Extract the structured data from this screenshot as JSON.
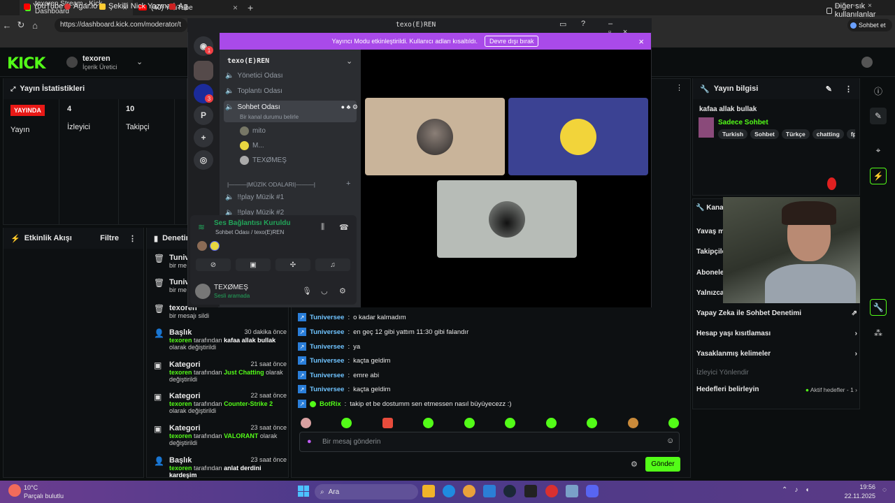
{
  "browser": {
    "tabs": [
      {
        "label": "texoren Stream - Kick Dashboard"
      },
      {
        "label": "(40) YouTube"
      }
    ],
    "url": "https://dashboard.kick.com/moderator/t",
    "bookmarks": [
      "YouTube",
      "Agar.io",
      "Şekilli Nick Yazma |...",
      "Ag"
    ],
    "other_bookmarks": "Diğer sık kullanılanlar",
    "profile_label": "Sohbet et"
  },
  "kick": {
    "logo": "KICK",
    "user_name": "texoren",
    "user_role": "İçerik Üretici",
    "stats_title": "Yayın İstatistikleri",
    "live_badge": "YAYINDA",
    "live_label": "Yayın",
    "viewers_value": "4",
    "viewers_label": "İzleyici",
    "followers_value": "10",
    "followers_label": "Takipçi",
    "activity_title": "Etkinlik Akışı",
    "filter_label": "Filtre",
    "moderation_title": "Denetim",
    "mod_log": [
      {
        "title": "Tuniv",
        "desc": "bir me",
        "time": ""
      },
      {
        "title": "Tuniv",
        "desc": "bir me",
        "time": ""
      },
      {
        "title": "texoren",
        "desc": "bir mesajı sildi",
        "time": ""
      },
      {
        "title": "Başlık",
        "time": "30 dakika önce",
        "user": "texoren",
        "mid": " tarafından ",
        "value": "kafaa allak bullak",
        "tail": " olarak değiştirildi"
      },
      {
        "title": "Kategori",
        "time": "21 saat önce",
        "user": "texoren",
        "mid": " tarafından ",
        "value": "Just Chatting",
        "tail": " olarak değiştirildi"
      },
      {
        "title": "Kategori",
        "time": "22 saat önce",
        "user": "texoren",
        "mid": " tarafından ",
        "value": "Counter-Strike 2",
        "tail": " olarak değiştirildi"
      },
      {
        "title": "Kategori",
        "time": "23 saat önce",
        "user": "texoren",
        "mid": " tarafından ",
        "value": "VALORANT",
        "tail": " olarak değiştirildi"
      },
      {
        "title": "Başlık",
        "time": "23 saat önce",
        "user": "texoren",
        "mid": " tarafından ",
        "value": "anlat derdini kardeşim",
        "tail": ""
      }
    ],
    "chat": [
      {
        "user": "Tuniversee",
        "msg": "o kadar kalmadım"
      },
      {
        "user": "Tuniversee",
        "msg": "en geç 12 gibi yattım 11:30 gibi falandır"
      },
      {
        "user": "Tuniversee",
        "msg": "ya"
      },
      {
        "user": "Tuniversee",
        "msg": "kaçta geldim"
      },
      {
        "user": "Tuniversee",
        "msg": "emre abi"
      },
      {
        "user": "Tuniversee",
        "msg": "kaçta geldim"
      },
      {
        "user": "BotRix",
        "msg": "takip et be dostumm sen etmessen nasıl büyüyecezz :)"
      }
    ],
    "chat_placeholder": "Bir mesaj gönderin",
    "send_label": "Gönder",
    "stream_info_title": "Yayın bilgisi",
    "stream_title": "kafaa allak bullak",
    "category": "Sadece Sohbet",
    "tags": [
      "Turkish",
      "Sohbet",
      "Türkçe",
      "chatting",
      "fps"
    ],
    "channel_title": "Kana",
    "settings_items": [
      "Yavaş m",
      "Takipçile",
      "Abonele",
      "Yalnızca"
    ],
    "ai_moderation": "Yapay Zeka ile Sohbet Denetimi",
    "age_restrict": "Hesap yaşı kısıtlaması",
    "banned_words": "Yasaklanmış kelimeler",
    "viewer_guide": "İzleyici Yönlendir",
    "set_goals": "Hedefleri belirleyin",
    "active_goals": "Aktif hedefler - 1"
  },
  "discord": {
    "window_title": "texo(E)REN",
    "notice": "Yayıncı Modu etkinleştirildi. Kullanıcı adları kısaltıldı.",
    "notice_button": "Devre dışı bırak",
    "server_name": "texo(E)REN",
    "guild_badges": [
      "1",
      "3"
    ],
    "guild_letter": "P",
    "channels": [
      "Yönetici Odası",
      "Toplantı Odası",
      "Sohbet Odası"
    ],
    "channel_status": "Bir kanal durumu belirle",
    "members": [
      "mito",
      "M...",
      "TEXØMEŞ"
    ],
    "music_category": "|———|MÜZİK ODALARI|———|",
    "music_channels": [
      "!!play Müzik #1",
      "!!play Müzik #2"
    ],
    "voice_status": "Ses Bağlantısı Kuruldu",
    "voice_location": "Sohbet Odası / texo(E)REN",
    "self_name": "TEXØMEŞ",
    "self_status": "Sesli aramada"
  },
  "taskbar": {
    "weather_temp": "10°C",
    "weather_desc": "Parçalı bulutlu",
    "search_label": "Ara",
    "time": "19:56",
    "date": "22.11.2025"
  },
  "colors": {
    "kick_green": "#53fc18",
    "discord_purple": "#a94ae9",
    "live_red": "#e91916"
  }
}
